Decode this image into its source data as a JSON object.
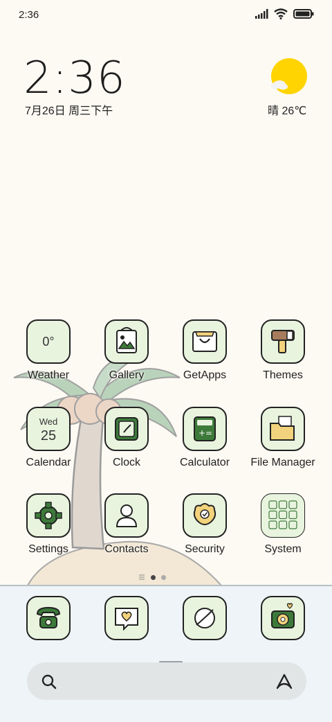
{
  "status_bar": {
    "time": "2:36",
    "icons": [
      "signal-icon",
      "wifi-icon",
      "battery-icon"
    ]
  },
  "clock_widget": {
    "time": "2:36",
    "date": "7月26日 周三下午"
  },
  "weather_widget": {
    "icon": "sun-cloud-icon",
    "text": "晴 26℃"
  },
  "apps": [
    {
      "label": "Weather",
      "icon": "weather-icon",
      "icon_text": "0°"
    },
    {
      "label": "Gallery",
      "icon": "gallery-icon"
    },
    {
      "label": "GetApps",
      "icon": "getapps-icon"
    },
    {
      "label": "Themes",
      "icon": "themes-icon"
    },
    {
      "label": "Calendar",
      "icon": "calendar-icon",
      "icon_day": "Wed",
      "icon_date": "25"
    },
    {
      "label": "Clock",
      "icon": "clock-icon"
    },
    {
      "label": "Calculator",
      "icon": "calculator-icon"
    },
    {
      "label": "File Manager",
      "icon": "folder-icon"
    },
    {
      "label": "Settings",
      "icon": "gear-icon"
    },
    {
      "label": "Contacts",
      "icon": "contact-icon"
    },
    {
      "label": "Security",
      "icon": "security-icon"
    },
    {
      "label": "System",
      "icon": "system-folder-icon"
    }
  ],
  "dock": [
    {
      "icon": "phone-icon"
    },
    {
      "icon": "messages-icon"
    },
    {
      "icon": "browser-icon"
    },
    {
      "icon": "camera-icon"
    }
  ],
  "search_bar": {
    "left_icon": "search-icon",
    "right_icon": "assistant-icon"
  },
  "page_indicator": {
    "pages": 2,
    "current": 1
  },
  "colors": {
    "background": "#fdfaf3",
    "icon_fill": "#e9f4df",
    "icon_green": "#3d7a3a",
    "icon_yellow": "#f2d27c",
    "dock": "#eef4f7",
    "sun": "#ffd400"
  }
}
